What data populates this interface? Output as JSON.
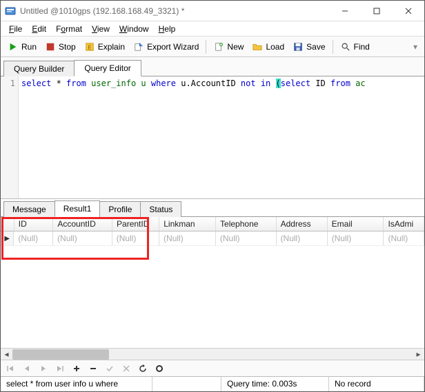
{
  "window": {
    "title": "Untitled @1010gps (192.168.168.49_3321) *"
  },
  "menu": {
    "file": "File",
    "edit": "Edit",
    "format": "Format",
    "view": "View",
    "window": "Window",
    "help": "Help"
  },
  "toolbar": {
    "run": "Run",
    "stop": "Stop",
    "explain": "Explain",
    "export_wizard": "Export Wizard",
    "new": "New",
    "load": "Load",
    "save": "Save",
    "find": "Find"
  },
  "main_tabs": {
    "builder": "Query Builder",
    "editor": "Query Editor"
  },
  "editor": {
    "line_no": "1",
    "sql_tokens": {
      "select": "select",
      "star": " * ",
      "from1": "from",
      "tbl": " user_info u ",
      "where": "where",
      "col": " u.AccountID ",
      "not": "not",
      "in": " in ",
      "lp": "(",
      "select2": "select",
      "idcol": " ID ",
      "from2": "from",
      "rest": " ac"
    }
  },
  "result_tabs": {
    "message": "Message",
    "result1": "Result1",
    "profile": "Profile",
    "status": "Status"
  },
  "grid": {
    "columns": [
      "ID",
      "AccountID",
      "ParentID",
      "Linkman",
      "Telephone",
      "Address",
      "Email",
      "IsAdmi"
    ],
    "widths": [
      58,
      88,
      70,
      84,
      90,
      76,
      84,
      60
    ],
    "row_indicator": "▶",
    "null_text": "(Null)"
  },
  "nav_icons": [
    "first",
    "prev",
    "next",
    "last",
    "plus",
    "minus",
    "check",
    "x",
    "refresh",
    "reset"
  ],
  "status": {
    "query_text": "select * from user info u where",
    "query_time": "Query time: 0.003s",
    "record": "No record"
  }
}
